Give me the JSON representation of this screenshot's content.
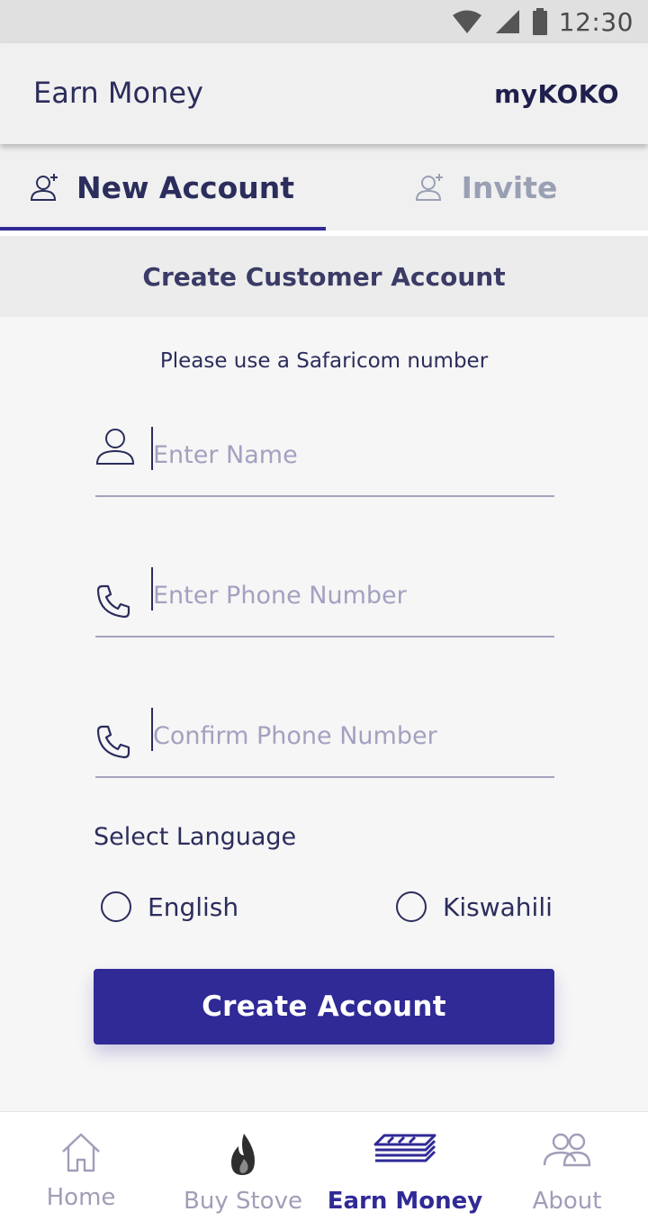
{
  "status_bar": {
    "time": "12:30"
  },
  "app_bar": {
    "title": "Earn Money",
    "brand": "myKOKO"
  },
  "tabs": [
    {
      "label": "New Account",
      "active": true,
      "icon": "add-user-icon"
    },
    {
      "label": "Invite",
      "active": false,
      "icon": "add-user-icon"
    }
  ],
  "section": {
    "title": "Create Customer Account"
  },
  "form": {
    "hint": "Please use a Safaricom number",
    "name_placeholder": "Enter Name",
    "phone_placeholder": "Enter Phone Number",
    "confirm_placeholder": "Confirm Phone Number",
    "language_label": "Select Language",
    "languages": [
      "English",
      "Kiswahili"
    ],
    "submit_label": "Create Account"
  },
  "bottom_nav": [
    {
      "label": "Home",
      "icon": "home-icon",
      "active": false
    },
    {
      "label": "Buy Stove",
      "icon": "flame-icon",
      "active": false
    },
    {
      "label": "Earn Money",
      "icon": "money-stack-icon",
      "active": true
    },
    {
      "label": "About",
      "icon": "people-icon",
      "active": false
    }
  ],
  "colors": {
    "primary": "#302a96",
    "text_dark": "#2b2d5c",
    "muted": "#a09eb8"
  }
}
